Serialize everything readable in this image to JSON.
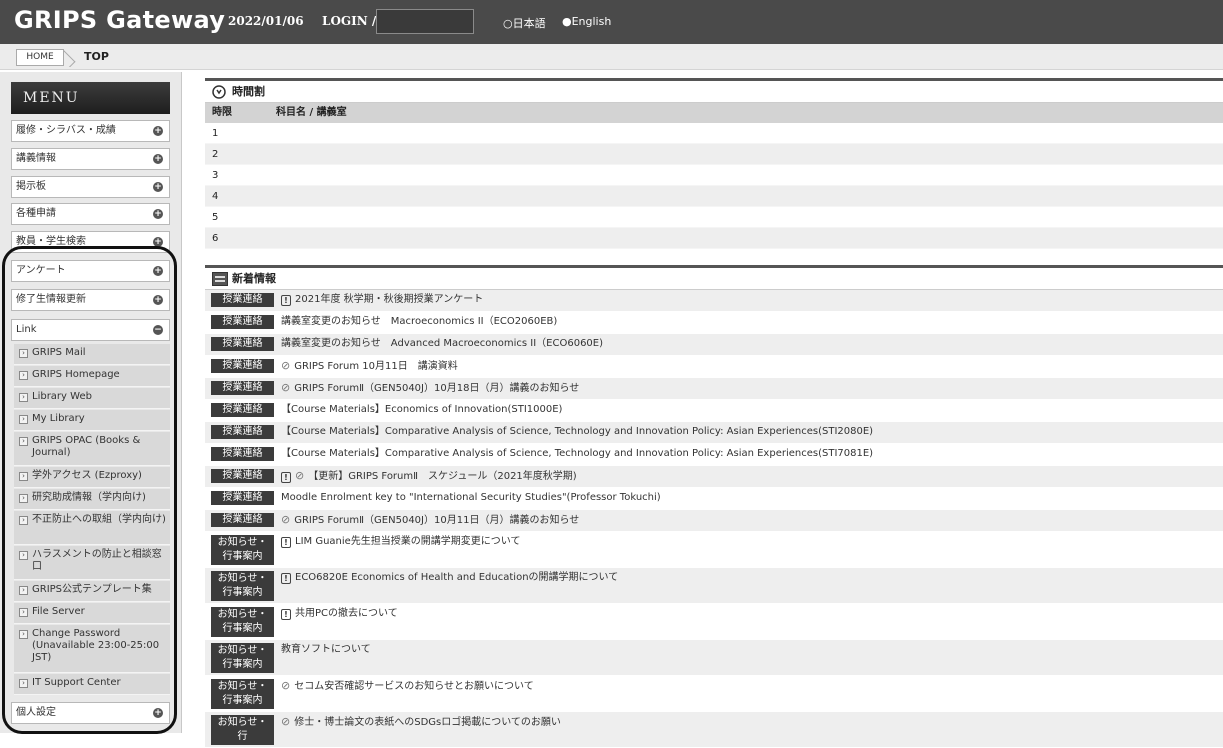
{
  "header": {
    "title": "GRIPS Gateway",
    "date": "2022/01/06",
    "login_label": "LOGIN /",
    "lang_ja": "○日本語",
    "lang_en": "●English"
  },
  "breadcrumb": {
    "home": "HOME",
    "current": "TOP"
  },
  "sidebar": {
    "menu_title": "MENU",
    "items": [
      {
        "label": "履修・シラバス・成績"
      },
      {
        "label": "講義情報"
      },
      {
        "label": "掲示板"
      },
      {
        "label": "各種申請"
      },
      {
        "label": "教員・学生検索"
      },
      {
        "label": "アンケート"
      },
      {
        "label": "修了生情報更新"
      },
      {
        "label": "Link"
      }
    ],
    "links": [
      {
        "label": "GRIPS Mail"
      },
      {
        "label": "GRIPS Homepage"
      },
      {
        "label": "Library Web"
      },
      {
        "label": "My Library"
      },
      {
        "label": "GRIPS OPAC (Books & Journal)"
      },
      {
        "label": "学外アクセス (Ezproxy)"
      },
      {
        "label": "研究助成情報（学内向け)"
      },
      {
        "label": "不正防止への取組（学内向け)"
      },
      {
        "label": "ハラスメントの防止と相談窓口"
      },
      {
        "label": "GRIPS公式テンプレート集"
      },
      {
        "label": "File Server"
      },
      {
        "label": "Change Password (Unavailable 23:00-25:00 JST)"
      },
      {
        "label": "IT Support Center"
      }
    ],
    "personal": "個人設定"
  },
  "timetable": {
    "title": "時間割",
    "col_period": "時限",
    "col_subject": "科目名 / 講義室",
    "rows": [
      "1",
      "2",
      "3",
      "4",
      "5",
      "6"
    ]
  },
  "news": {
    "title": "新着情報",
    "items": [
      {
        "badge": "授業連絡",
        "icon": "notice",
        "text": "2021年度 秋学期・秋後期授業アンケート"
      },
      {
        "badge": "授業連絡",
        "icon": "",
        "text": "講義室変更のお知らせ　Macroeconomics II（ECO2060EB)"
      },
      {
        "badge": "授業連絡",
        "icon": "",
        "text": "講義室変更のお知らせ　Advanced Macroeconomics II（ECO6060E)"
      },
      {
        "badge": "授業連絡",
        "icon": "attachment",
        "text": "GRIPS Forum 10月11日　講演資料"
      },
      {
        "badge": "授業連絡",
        "icon": "attachment",
        "text": "GRIPS ForumⅡ（GEN5040J）10月18日（月）講義のお知らせ"
      },
      {
        "badge": "授業連絡",
        "icon": "",
        "text": "【Course Materials】Economics of Innovation(STI1000E)"
      },
      {
        "badge": "授業連絡",
        "icon": "",
        "text": "【Course Materials】Comparative Analysis of Science, Technology and Innovation Policy: Asian Experiences(STI2080E)"
      },
      {
        "badge": "授業連絡",
        "icon": "",
        "text": "【Course Materials】Comparative Analysis of Science, Technology and Innovation Policy: Asian Experiences(STI7081E)"
      },
      {
        "badge": "授業連絡",
        "icon": "notice-attachment",
        "text": "【更新】GRIPS ForumⅡ　スケジュール（2021年度秋学期)"
      },
      {
        "badge": "授業連絡",
        "icon": "",
        "text": "Moodle Enrolment key to \"International Security Studies\"(Professor Tokuchi)"
      },
      {
        "badge": "授業連絡",
        "icon": "attachment",
        "text": "GRIPS ForumⅡ（GEN5040J）10月11日（月）講義のお知らせ"
      },
      {
        "badge": "お知らせ・行事案内",
        "icon": "notice",
        "text": "LIM Guanie先生担当授業の開講学期変更について"
      },
      {
        "badge": "お知らせ・行事案内",
        "icon": "notice",
        "text": "ECO6820E Economics of Health and Educationの開講学期について"
      },
      {
        "badge": "お知らせ・行事案内",
        "icon": "notice",
        "text": "共用PCの撤去について"
      },
      {
        "badge": "お知らせ・行事案内",
        "icon": "",
        "text": "教育ソフトについて"
      },
      {
        "badge": "お知らせ・行事案内",
        "icon": "attachment",
        "text": "セコム安否確認サービスのお知らせとお願いについて"
      },
      {
        "badge": "お知らせ・行",
        "icon": "attachment",
        "text": "修士・博士論文の表紙へのSDGsロゴ掲載についてのお願い"
      }
    ]
  }
}
